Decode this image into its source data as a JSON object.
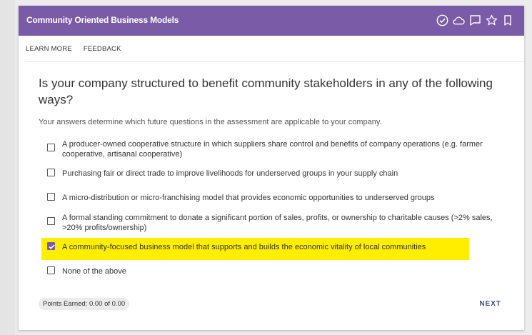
{
  "header": {
    "title": "Community Oriented Business Models",
    "icons": [
      "check-circle-icon",
      "cloud-icon",
      "comment-icon",
      "star-icon",
      "bookmark-icon"
    ]
  },
  "toolbar": {
    "learn_more": "LEARN MORE",
    "feedback": "FEEDBACK"
  },
  "question": {
    "text": "Is your company structured to benefit community stakeholders in any of the following ways?",
    "subtext": "Your answers determine which future questions in the assessment are applicable to your company."
  },
  "options": [
    {
      "label": "A producer-owned cooperative structure in which suppliers share control and benefits of company operations (e.g. farmer cooperative, artisanal cooperative)",
      "checked": false
    },
    {
      "label": "Purchasing fair or direct trade to improve livelihoods for underserved groups in your supply chain",
      "checked": false
    },
    {
      "label": "A micro-distribution or micro-franchising model that provides economic opportunities to underserved groups",
      "checked": false
    },
    {
      "label": "A formal standing commitment to donate a significant portion of sales, profits, or ownership to charitable causes (>2% sales, >20% profits/ownership)",
      "checked": false
    },
    {
      "label": "A community-focused business model that supports and builds the economic vitality of local communities",
      "checked": true
    },
    {
      "label": "None of the above",
      "checked": false
    }
  ],
  "footer": {
    "points": "Points Earned: 0.00 of 0.00",
    "next": "NEXT"
  },
  "colors": {
    "header": "#7a5ba7",
    "highlight": "#ffee00",
    "next": "#3b4b78"
  }
}
